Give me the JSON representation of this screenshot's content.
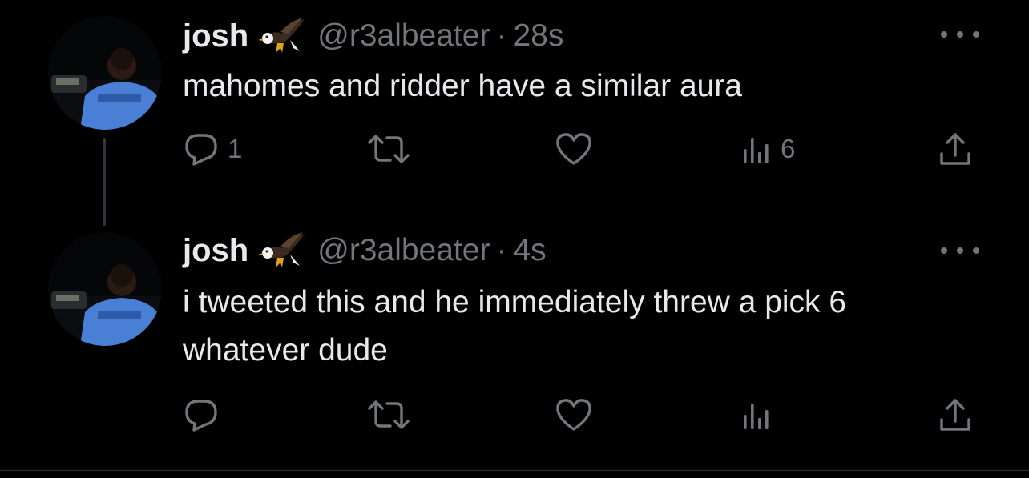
{
  "colors": {
    "background": "#000000",
    "text_primary": "#e7e9ea",
    "text_secondary": "#71767b",
    "thread_line": "#333639",
    "avatar_hoodie": "#4a7fd6"
  },
  "tweets": [
    {
      "author": {
        "name": "josh",
        "badge_icon": "eagle-emoji",
        "handle": "@r3albeater"
      },
      "separator": "·",
      "time": "28s",
      "text": "mahomes and ridder have a similar aura",
      "actions": {
        "reply_count": "1",
        "retweet_count": "",
        "like_count": "",
        "views_count": "6"
      }
    },
    {
      "author": {
        "name": "josh",
        "badge_icon": "eagle-emoji",
        "handle": "@r3albeater"
      },
      "separator": "·",
      "time": "4s",
      "text": "i tweeted this and he immediately threw a pick 6 whatever dude",
      "actions": {
        "reply_count": "",
        "retweet_count": "",
        "like_count": "",
        "views_count": ""
      }
    }
  ]
}
